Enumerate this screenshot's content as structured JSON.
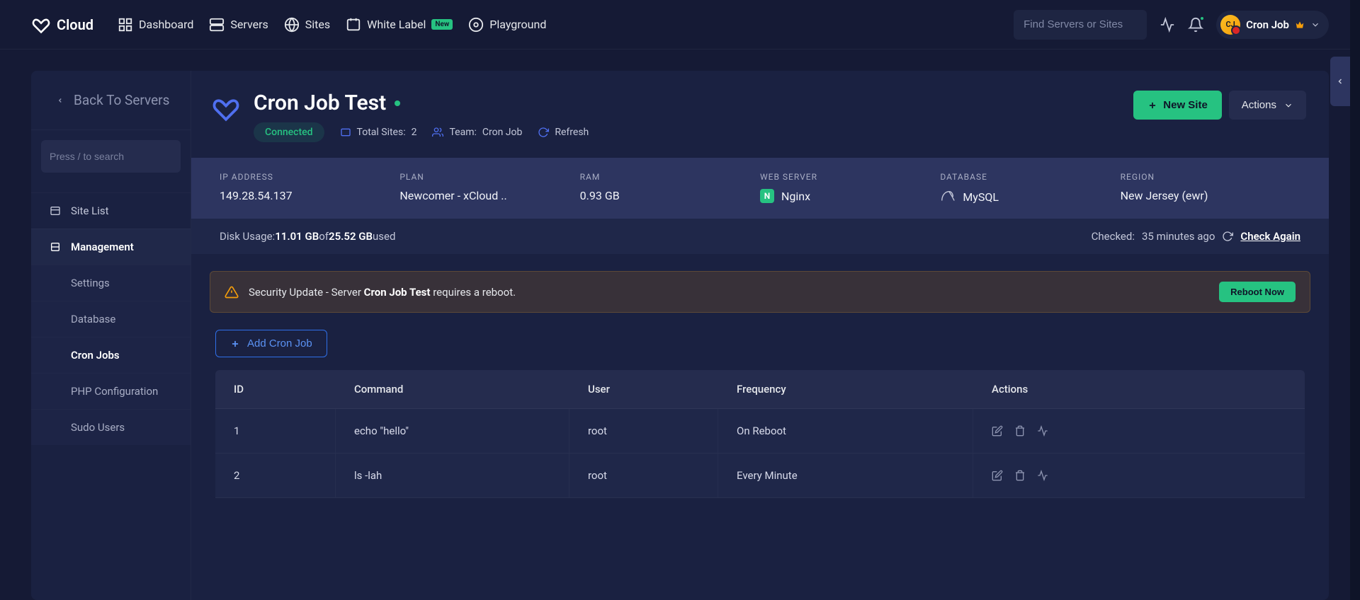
{
  "brand": "Cloud",
  "nav": {
    "dashboard": "Dashboard",
    "servers": "Servers",
    "sites": "Sites",
    "white_label": "White Label",
    "white_label_badge": "New",
    "playground": "Playground",
    "search_placeholder": "Find Servers or Sites",
    "user_name": "Cron Job"
  },
  "sidebar": {
    "back": "Back To Servers",
    "search_placeholder": "Press / to search",
    "site_list": "Site List",
    "management": "Management",
    "subs": {
      "settings": "Settings",
      "database": "Database",
      "cron_jobs": "Cron Jobs",
      "php": "PHP Configuration",
      "sudo": "Sudo Users"
    }
  },
  "server": {
    "title": "Cron Job Test",
    "status": "Connected",
    "total_sites_label": "Total Sites: ",
    "total_sites_value": "2",
    "team_label": "Team: ",
    "team_value": "Cron Job",
    "refresh": "Refresh",
    "new_site_btn": "New Site",
    "actions_btn": "Actions"
  },
  "info": {
    "ip_label": "IP ADDRESS",
    "ip": "149.28.54.137",
    "plan_label": "PLAN",
    "plan": "Newcomer - xCloud ..",
    "ram_label": "RAM",
    "ram": "0.93 GB",
    "web_label": "WEB SERVER",
    "web": "Nginx",
    "db_label": "DATABASE",
    "db": "MySQL",
    "region_label": "REGION",
    "region": "New Jersey (ewr)"
  },
  "disk": {
    "prefix": "Disk Usage: ",
    "used": "11.01 GB",
    "of": " of ",
    "total": "25.52 GB",
    "suffix": " used",
    "checked_prefix": "Checked: ",
    "checked": "35 minutes ago",
    "check_again": "Check Again"
  },
  "alert": {
    "prefix": "Security Update - Server ",
    "server": "Cron Job Test",
    "suffix": " requires a reboot.",
    "button": "Reboot Now"
  },
  "cron": {
    "add_btn": "Add Cron Job",
    "headers": {
      "id": "ID",
      "command": "Command",
      "user": "User",
      "frequency": "Frequency",
      "actions": "Actions"
    },
    "rows": [
      {
        "id": "1",
        "command": "echo \"hello\"",
        "user": "root",
        "frequency": "On Reboot"
      },
      {
        "id": "2",
        "command": "ls -lah",
        "user": "root",
        "frequency": "Every Minute"
      }
    ]
  }
}
